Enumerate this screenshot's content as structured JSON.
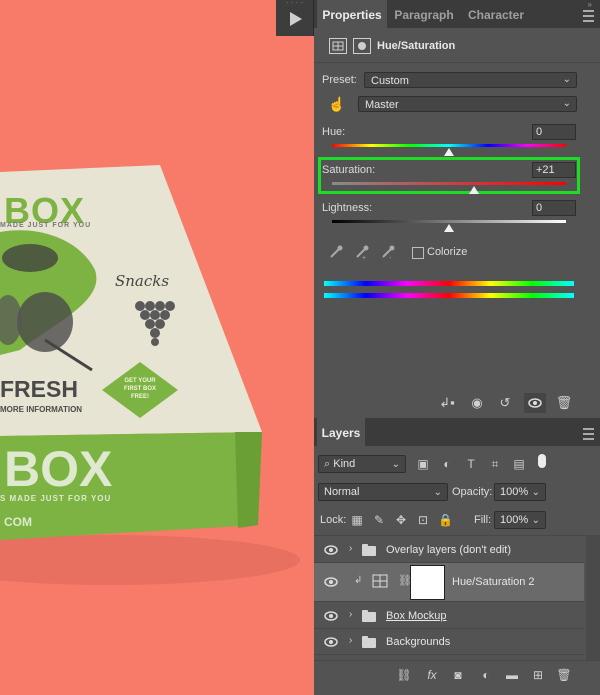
{
  "properties_tabs": [
    "Properties",
    "Paragraph",
    "Character"
  ],
  "adjustment": {
    "title": "Hue/Saturation"
  },
  "preset": {
    "label": "Preset:",
    "value": "Custom"
  },
  "channel": {
    "value": "Master"
  },
  "hue": {
    "label": "Hue:",
    "value": "0",
    "slider_fraction": 0.5
  },
  "saturation": {
    "label": "Saturation:",
    "value": "+21",
    "slider_fraction": 0.605
  },
  "lightness": {
    "label": "Lightness:",
    "value": "0",
    "slider_fraction": 0.5
  },
  "colorize": {
    "label": "Colorize",
    "checked": false
  },
  "layers_panel": {
    "tab": "Layers",
    "filter": "Kind",
    "blend_mode": "Normal",
    "opacity_label": "Opacity:",
    "opacity_value": "100%",
    "lock_label": "Lock:",
    "fill_label": "Fill:",
    "fill_value": "100%",
    "layers": [
      {
        "name": "Overlay layers (don't edit)",
        "type": "group"
      },
      {
        "name": "Hue/Saturation 2",
        "type": "adjustment",
        "selected": true
      },
      {
        "name": "Box Mockup",
        "type": "group"
      },
      {
        "name": "Backgrounds",
        "type": "group"
      }
    ]
  },
  "box_artwork": {
    "brand_top": "BOX",
    "tagline_top": "MADE JUST FOR YOU",
    "snacks": "Snacks",
    "fresh": "FRESH",
    "more_info": "MORE INFORMATION",
    "badge": [
      "GET YOUR",
      "FIRST BOX",
      "FREE!"
    ],
    "brand_front": "BOX",
    "tagline_front": "S MADE JUST FOR YOU",
    "url": "COM"
  },
  "colors": {
    "canvas_bg": "#f77b68",
    "panel_bg": "#535353",
    "highlight": "#1bdd24",
    "box_green": "#7cb342",
    "box_cream": "#e8e4d3"
  }
}
